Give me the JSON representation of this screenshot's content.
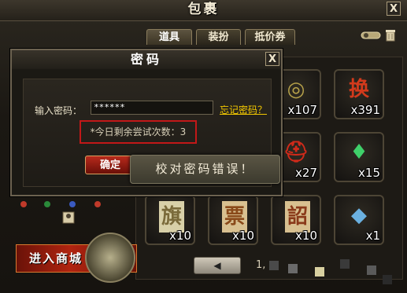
{
  "window": {
    "title": "包裹",
    "close_label": "X"
  },
  "tabs": [
    {
      "label": "道具",
      "active": true
    },
    {
      "label": "装扮",
      "active": false
    },
    {
      "label": "抵价券",
      "active": false
    }
  ],
  "inventory": {
    "items": [
      {
        "name": "coin-item-icon",
        "glyph": "◎",
        "color": "#b7a24a",
        "count": "x107"
      },
      {
        "name": "exchange-token-icon",
        "glyph": "换",
        "color": "#d23a1c",
        "count": "x391"
      },
      {
        "name": "red-helmet-icon",
        "glyph": "⛑",
        "color": "#d02a1a",
        "count": "x27"
      },
      {
        "name": "green-crystal-icon",
        "glyph": "♦",
        "color": "#3fd06a",
        "count": "x15"
      },
      {
        "name": "flag-scroll-icon",
        "glyph": "旗",
        "color": "#7a6a3a",
        "count": "x10"
      },
      {
        "name": "ticket-scroll-icon",
        "glyph": "票",
        "color": "#8a4a1a",
        "count": "x10"
      },
      {
        "name": "edict-scroll-icon",
        "glyph": "詔",
        "color": "#8a3a1a",
        "count": "x10"
      },
      {
        "name": "crystal-lantern-icon",
        "glyph": "◆",
        "color": "#6ab0e0",
        "count": "x1"
      }
    ],
    "page_prefix": "1,"
  },
  "password_dialog": {
    "title": "密码",
    "close_label": "X",
    "password_label": "输入密码：",
    "password_value": "******",
    "forgot_link": "忘记密码？",
    "attempts_text": "*今日剩余尝试次数：3",
    "confirm_label": "确定"
  },
  "toast": {
    "message": "校对密码错误！"
  },
  "mall": {
    "banner_label": "进入商城"
  },
  "colors": {
    "accent_gold": "#f4c900",
    "error_red": "#c21818",
    "confirm_red": "#b82a1c"
  }
}
